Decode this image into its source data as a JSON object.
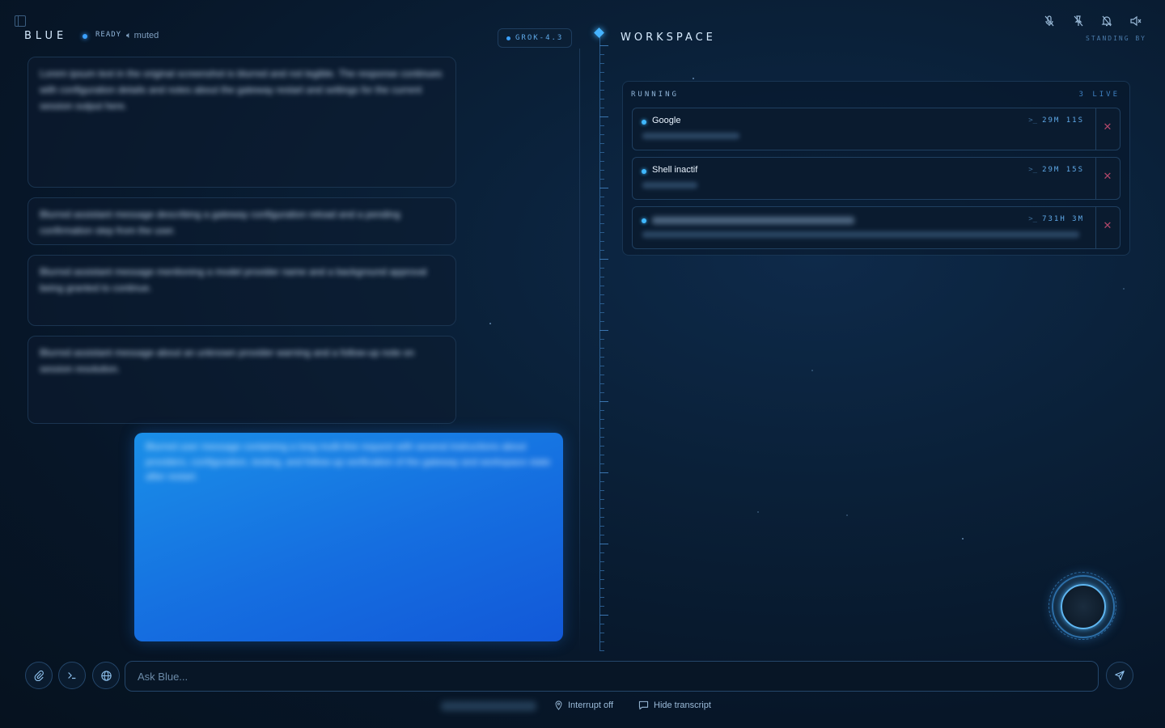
{
  "header": {
    "brand": "BLUE",
    "status": "READY",
    "muted_label": "muted",
    "model": "GROK-4.3"
  },
  "chat": {
    "messages": [
      {
        "role": "assistant",
        "text": "Lorem ipsum text in the original screenshot is blurred and not legible. The response continues with configuration details and notes about the gateway restart and settings for the current session output here."
      },
      {
        "role": "assistant",
        "text": "Blurred assistant message describing a gateway configuration reload and a pending confirmation step from the user."
      },
      {
        "role": "assistant",
        "text": "Blurred assistant message mentioning a model provider name and a background approval being granted to continue."
      },
      {
        "role": "assistant",
        "text": "Blurred assistant message about an unknown provider warning and a follow-up note on session resolution."
      },
      {
        "role": "user",
        "text": "Blurred user message containing a long multi-line request with several instructions about providers, configuration, testing, and follow-up verification of the gateway and workspace state after restart."
      }
    ]
  },
  "workspace": {
    "title": "WORKSPACE",
    "standing_by": "STANDING BY",
    "panel_title": "RUNNING",
    "live_count": "3 LIVE",
    "tasks": [
      {
        "name": "Google",
        "time": "29M 11S"
      },
      {
        "name": "Shell inactif",
        "time": "29M 15S"
      },
      {
        "name": "",
        "time": "731H 3M"
      }
    ]
  },
  "input": {
    "placeholder": "Ask Blue..."
  },
  "footer": {
    "interrupt": "Interrupt off",
    "transcript": "Hide transcript"
  },
  "icons": [
    "sidebar-toggle-icon",
    "speaker-muted-icon",
    "mic-off-icon",
    "pin-off-icon",
    "bell-off-icon",
    "volume-x-icon",
    "paperclip-icon",
    "terminal-icon",
    "globe-icon",
    "send-icon",
    "close-icon",
    "pin-icon",
    "chat-bubble-icon"
  ],
  "colors": {
    "accent": "#3aa0ff",
    "user_bubble": "#156ee0",
    "close": "#b0476a"
  }
}
